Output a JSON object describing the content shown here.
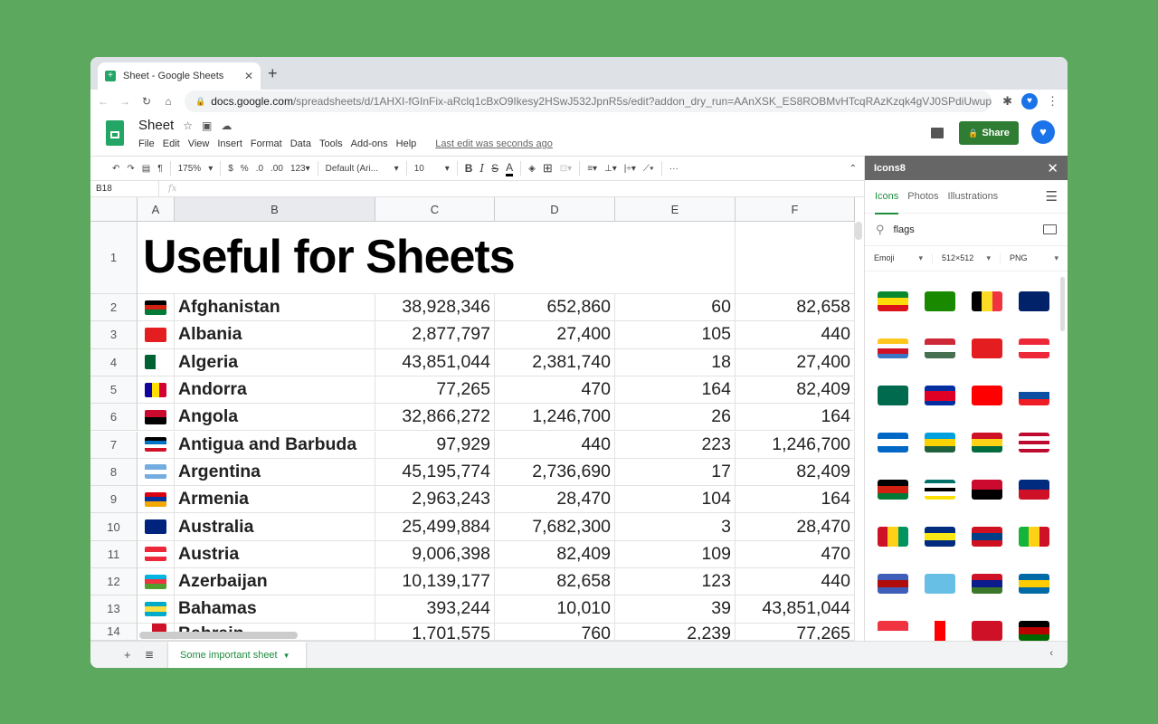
{
  "browser": {
    "tab_title": "Sheet - Google Sheets",
    "url_host": "docs.google.com",
    "url_path": "/spreadsheets/d/1AHXI-fGInFix-aRclq1cBxO9Ikesy2HSwJ532JpnR5s/edit?addon_dry_run=AAnXSK_ES8ROBMvHTcqRAzKzqk4gVJ0SPdiUwupw9osSB..."
  },
  "doc": {
    "title": "Sheet",
    "menus": [
      "File",
      "Edit",
      "View",
      "Insert",
      "Format",
      "Data",
      "Tools",
      "Add-ons",
      "Help"
    ],
    "last_edit": "Last edit was seconds ago",
    "share": "Share"
  },
  "toolbar": {
    "zoom": "175%",
    "currency": "$",
    "percent": "%",
    "dec_less": ".0",
    "dec_more": ".00",
    "format": "123▾",
    "font": "Default (Ari...",
    "size": "10",
    "bold": "B",
    "italic": "I",
    "strike": "S",
    "textcolor": "A",
    "more": "···"
  },
  "formula": {
    "cell_ref": "B18",
    "fx": "fx",
    "value": ""
  },
  "columns": [
    "A",
    "B",
    "C",
    "D",
    "E",
    "F"
  ],
  "title_cell": "Useful for Sheets",
  "rows": [
    {
      "n": "2",
      "flag": "h:#000|#d32011|#007a36",
      "name": "Afghanistan",
      "c": "38,928,346",
      "d": "652,860",
      "e": "60",
      "f": "82,658"
    },
    {
      "n": "3",
      "flag": "h:#e41e20",
      "name": "Albania",
      "c": "2,877,797",
      "d": "27,400",
      "e": "105",
      "f": "440"
    },
    {
      "n": "4",
      "flag": "v:#006233|#fff",
      "name": "Algeria",
      "c": "43,851,044",
      "d": "2,381,740",
      "e": "18",
      "f": "27,400"
    },
    {
      "n": "5",
      "flag": "v:#10069f|#fedf00|#d50032",
      "name": "Andorra",
      "c": "77,265",
      "d": "470",
      "e": "164",
      "f": "82,409"
    },
    {
      "n": "6",
      "flag": "h:#cc092f|#000",
      "name": "Angola",
      "c": "32,866,272",
      "d": "1,246,700",
      "e": "26",
      "f": "164"
    },
    {
      "n": "7",
      "flag": "h:#000|#0072c6|#fff|#ce1126",
      "name": "Antigua and Barbuda",
      "c": "97,929",
      "d": "440",
      "e": "223",
      "f": "1,246,700"
    },
    {
      "n": "8",
      "flag": "h:#74acdf|#fff|#74acdf",
      "name": "Argentina",
      "c": "45,195,774",
      "d": "2,736,690",
      "e": "17",
      "f": "82,409"
    },
    {
      "n": "9",
      "flag": "h:#d90012|#0033a0|#f2a800",
      "name": "Armenia",
      "c": "2,963,243",
      "d": "28,470",
      "e": "104",
      "f": "164"
    },
    {
      "n": "10",
      "flag": "h:#00247d|#00247d",
      "name": "Australia",
      "c": "25,499,884",
      "d": "7,682,300",
      "e": "3",
      "f": "28,470"
    },
    {
      "n": "11",
      "flag": "h:#ed2939|#fff|#ed2939",
      "name": "Austria",
      "c": "9,006,398",
      "d": "82,409",
      "e": "109",
      "f": "470"
    },
    {
      "n": "12",
      "flag": "h:#00b5e2|#ef3340|#509e2f",
      "name": "Azerbaijan",
      "c": "10,139,177",
      "d": "82,658",
      "e": "123",
      "f": "440"
    },
    {
      "n": "13",
      "flag": "h:#00abc9|#fae042|#00abc9",
      "name": "Bahamas",
      "c": "393,244",
      "d": "10,010",
      "e": "39",
      "f": "43,851,044"
    },
    {
      "n": "14",
      "flag": "v:#fff|#ce1126|#ce1126",
      "name": "Bahrain",
      "c": "1,701,575",
      "d": "760",
      "e": "2,239",
      "f": "77,265"
    }
  ],
  "sheet_tab": "Some important sheet",
  "panel": {
    "title": "Icons8",
    "tabs": [
      "Icons",
      "Photos",
      "Illustrations"
    ],
    "search": "flags",
    "options": [
      "Emoji",
      "512×512",
      "PNG"
    ],
    "flags": [
      "h:#078930|#fcdd09|#da121a",
      "h:#198a00|#198a00",
      "v:#000|#fdda24|#ef3340",
      "h:#012169|#012169",
      "h:#ffc61e|#fff|#ce1126|#3a75c4",
      "h:#ce2939|#fff|#477050",
      "h:#e41e20",
      "h:#ed2939|#fff|#ed2939",
      "h:#006a4e|#006a4e",
      "h:#032ea1|#e00025|#e00025|#032ea1",
      "h:#fe0000|#fe0000",
      "h:#fff|#0b4ea2|#ee1c25",
      "h:#0067c6|#fff|#0067c6",
      "h:#00a1de|#fad201|#20603d",
      "h:#ce1126|#fcd116|#006b3f",
      "h:#bf0a30|#fff|#bf0a30|#fff|#bf0a30",
      "h:#000|#d32011|#007a36",
      "h:#007168|#fff|#000|#fff|#fce100",
      "h:#cc092f|#000",
      "h:#002b7f|#ce1126",
      "v:#ce1126|#fcd116|#009460",
      "h:#002b7f|#f9e814|#002b7f",
      "h:#ce1021|#003f87|#ce1021",
      "v:#14b53a|#fcd116|#ce1126",
      "h:#3e5eb9|#b10c0c|#3e5eb9",
      "h:#68bfe5|#68bfe5",
      "h:#ce1126|#0c1c8c|#3a7728",
      "h:#006aa7|#fecc00|#006aa7",
      "h:#ef3340|#fff",
      "v:#fff|#ff0000|#fff",
      "h:#ce1126|#ce1126",
      "h:#000|#bb0000|#006600"
    ]
  }
}
